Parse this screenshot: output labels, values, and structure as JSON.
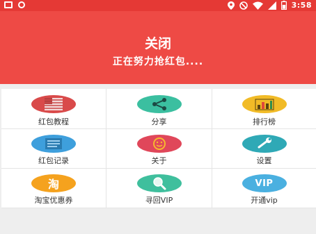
{
  "status_bar": {
    "time": "3:58",
    "icons": [
      "screen-icon",
      "alert-icon",
      "location-icon",
      "do-not-disturb-icon",
      "wifi-icon",
      "signal-icon",
      "battery-icon"
    ]
  },
  "header": {
    "close_label": "关闭",
    "status_text": "正在努力抢红包...."
  },
  "menu": {
    "items": [
      {
        "label": "红包教程",
        "icon": "flag-icon",
        "color": "#d94a4a"
      },
      {
        "label": "分享",
        "icon": "share-icon",
        "color": "#3bbfa0"
      },
      {
        "label": "排行榜",
        "icon": "bar-chart-icon",
        "color": "#f1bb27"
      },
      {
        "label": "红包记录",
        "icon": "list-icon",
        "color": "#3e9fdc"
      },
      {
        "label": "关于",
        "icon": "smile-icon",
        "color": "#e0475a"
      },
      {
        "label": "设置",
        "icon": "wrench-icon",
        "color": "#2fa9b6"
      },
      {
        "label": "淘宝优惠券",
        "icon": "taobao-icon",
        "icon_text": "淘",
        "color": "#f5a21e"
      },
      {
        "label": "寻回VIP",
        "icon": "magnifier-icon",
        "color": "#3fbf9d"
      },
      {
        "label": "开通vip",
        "icon": "vip-icon",
        "icon_text": "VIP",
        "color": "#4ab0e0"
      }
    ]
  },
  "colors": {
    "header_red": "#ee4a45",
    "status_red": "#e53935",
    "background": "#eeeeee"
  }
}
